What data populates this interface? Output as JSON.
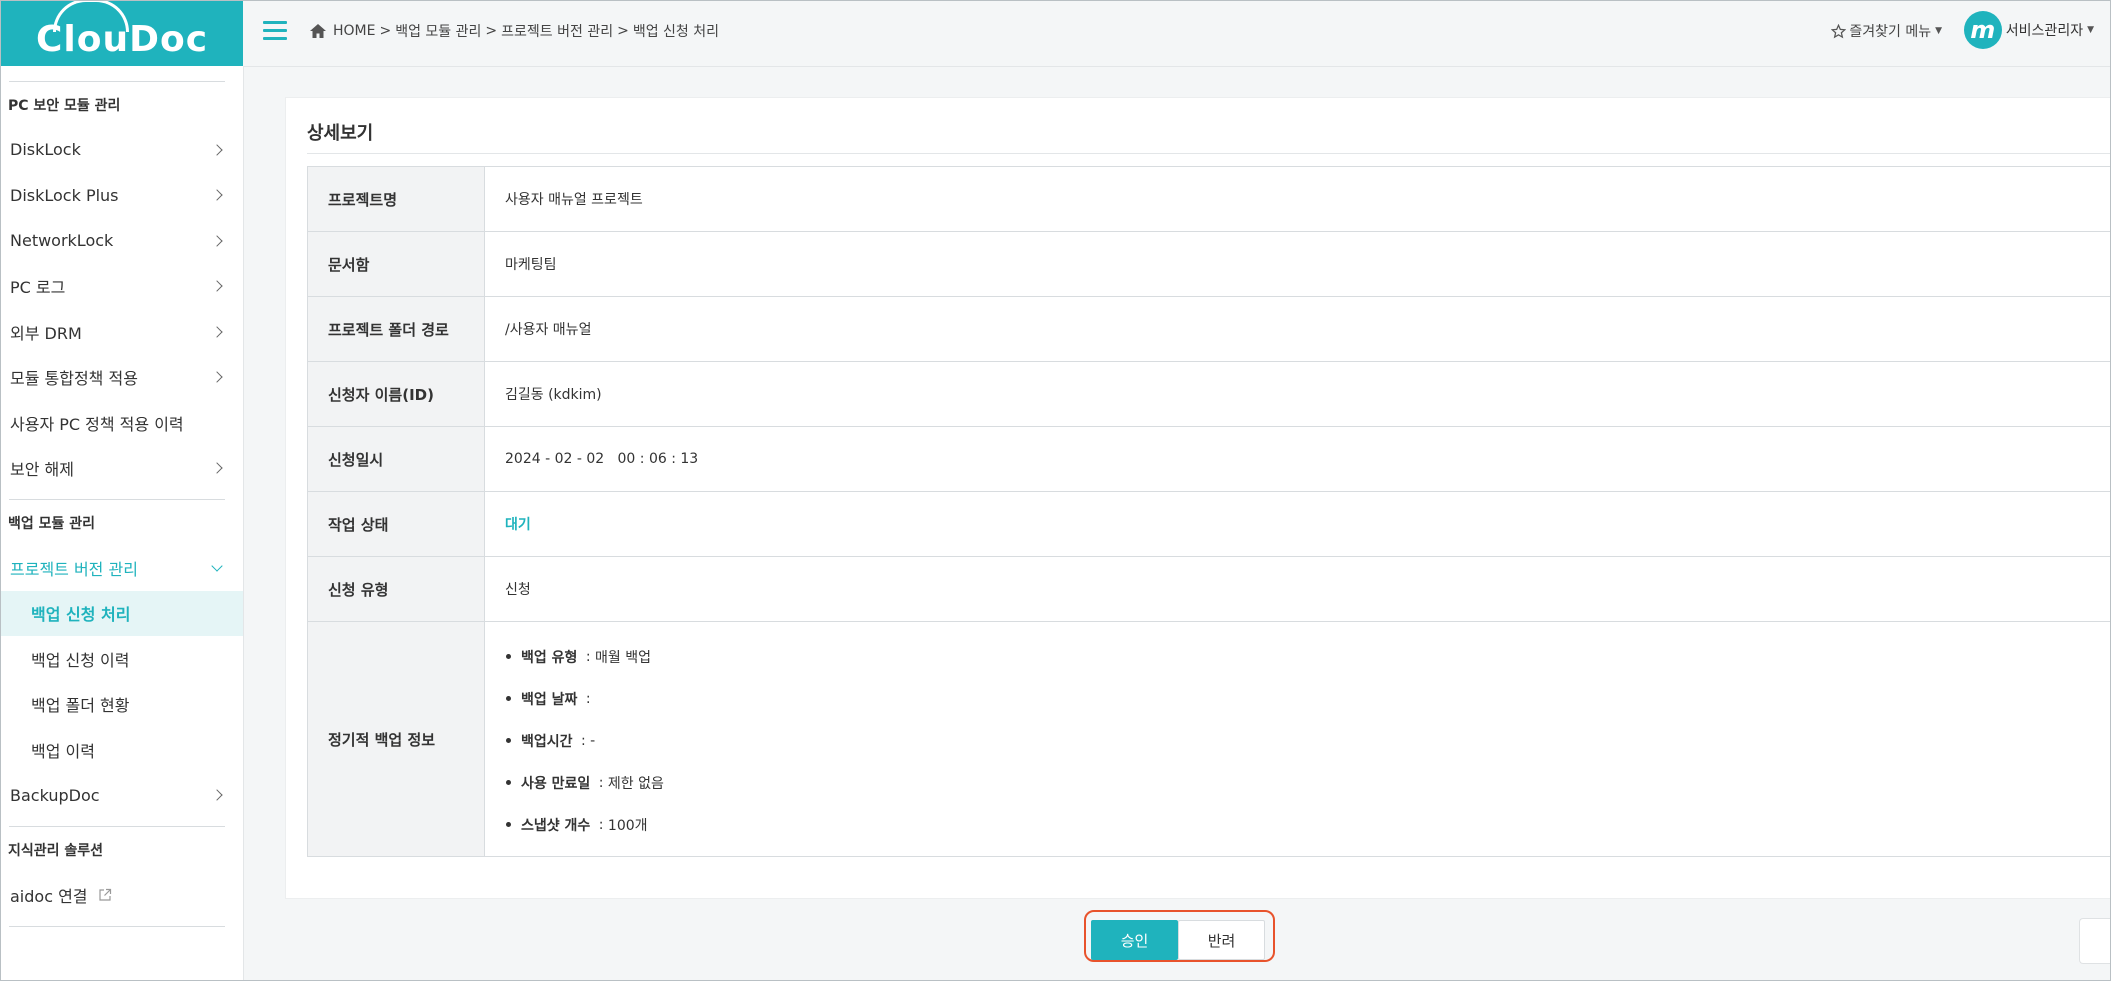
{
  "brand": {
    "logo_text": "ClouDoc",
    "accent": "#1fb3bd",
    "highlight_border": "#e8532c"
  },
  "header": {
    "breadcrumb": [
      "HOME",
      "백업 모듈 관리",
      "프로젝트 버전 관리",
      "백업 신청 처리"
    ],
    "breadcrumb_sep": ">",
    "favorites_label": "즐겨찾기 메뉴",
    "user_avatar_letter": "m",
    "user_name": "서비스관리자"
  },
  "sidebar": {
    "section1": "PC 보안 모듈 관리",
    "items1": [
      "DiskLock",
      "DiskLock Plus",
      "NetworkLock",
      "PC 로그",
      "외부 DRM",
      "모듈 통합정책 적용",
      "사용자 PC 정책 적용 이력",
      "보안 해제"
    ],
    "section2": "백업 모듈 관리",
    "project_version": "프로젝트 버전 관리",
    "subitems": [
      "백업 신청 처리",
      "백업 신청 이력",
      "백업 폴더 현황",
      "백업 이력"
    ],
    "backupdoc": "BackupDoc",
    "section3": "지식관리 솔루션",
    "aidoc": "aidoc 연결"
  },
  "detail": {
    "title": "상세보기",
    "rows": [
      {
        "label": "프로젝트명",
        "value": "사용자 매뉴얼 프로젝트"
      },
      {
        "label": "문서함",
        "value": "마케팅팀"
      },
      {
        "label": "프로젝트 폴더 경로",
        "value": "/사용자 매뉴얼"
      },
      {
        "label": "신청자 이름(ID)",
        "value": "김길동 (kdkim)"
      },
      {
        "label": "신청일시",
        "value": "2024 - 02 - 02   00 : 06 : 13"
      },
      {
        "label": "작업 상태",
        "value": "대기"
      },
      {
        "label": "신청 유형",
        "value": "신청"
      }
    ],
    "backup_info_label": "정기적 백업 정보",
    "backup_info": [
      {
        "key": "백업 유형",
        "sep": " : ",
        "value": "매월 백업"
      },
      {
        "key": "백업 날짜",
        "sep": " :",
        "value": ""
      },
      {
        "key": "백업시간",
        "sep": " : ",
        "value": "-"
      },
      {
        "key": "사용 만료일",
        "sep": " : ",
        "value": "제한 없음"
      },
      {
        "key": "스냅샷 개수",
        "sep": " : ",
        "value": "100개"
      }
    ]
  },
  "actions": {
    "approve": "승인",
    "reject": "반려"
  }
}
